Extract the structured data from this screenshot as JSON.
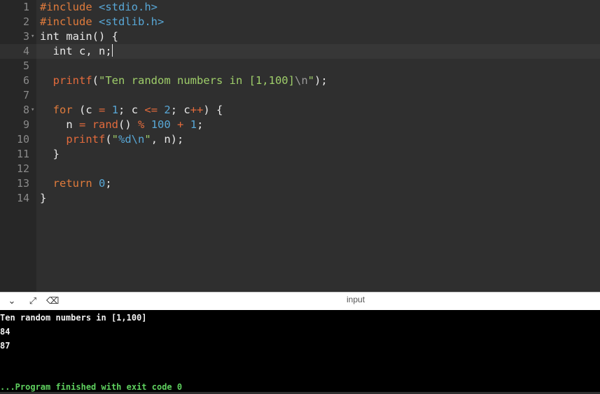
{
  "editor": {
    "lines": [
      {
        "n": "1",
        "tokens": [
          {
            "t": "#include ",
            "c": "pre"
          },
          {
            "t": "<stdio.h>",
            "c": "inc"
          }
        ]
      },
      {
        "n": "2",
        "tokens": [
          {
            "t": "#include ",
            "c": "pre"
          },
          {
            "t": "<stdlib.h>",
            "c": "inc"
          }
        ]
      },
      {
        "n": "3",
        "fold": "▾",
        "tokens": [
          {
            "t": "int main() {",
            "c": ""
          }
        ]
      },
      {
        "n": "4",
        "tokens": [
          {
            "t": "  int c, n;",
            "c": ""
          }
        ]
      },
      {
        "n": "5",
        "tokens": []
      },
      {
        "n": "6",
        "tokens": [
          {
            "t": "  ",
            "c": ""
          },
          {
            "t": "printf",
            "c": "fn"
          },
          {
            "t": "(",
            "c": ""
          },
          {
            "t": "\"Ten random numbers in [1,100]",
            "c": "str"
          },
          {
            "t": "\\n",
            "c": "esc"
          },
          {
            "t": "\"",
            "c": "str"
          },
          {
            "t": ");",
            "c": ""
          }
        ]
      },
      {
        "n": "7",
        "tokens": []
      },
      {
        "n": "8",
        "fold": "▾",
        "tokens": [
          {
            "t": "  ",
            "c": ""
          },
          {
            "t": "for",
            "c": "kw"
          },
          {
            "t": " (c ",
            "c": ""
          },
          {
            "t": "=",
            "c": "op"
          },
          {
            "t": " ",
            "c": ""
          },
          {
            "t": "1",
            "c": "num"
          },
          {
            "t": "; c ",
            "c": ""
          },
          {
            "t": "<=",
            "c": "op"
          },
          {
            "t": " ",
            "c": ""
          },
          {
            "t": "2",
            "c": "num"
          },
          {
            "t": "; c",
            "c": ""
          },
          {
            "t": "++",
            "c": "op"
          },
          {
            "t": ") {",
            "c": ""
          }
        ]
      },
      {
        "n": "9",
        "tokens": [
          {
            "t": "    n ",
            "c": ""
          },
          {
            "t": "=",
            "c": "op"
          },
          {
            "t": " ",
            "c": ""
          },
          {
            "t": "rand",
            "c": "fn"
          },
          {
            "t": "() ",
            "c": ""
          },
          {
            "t": "%",
            "c": "op"
          },
          {
            "t": " ",
            "c": ""
          },
          {
            "t": "100",
            "c": "num"
          },
          {
            "t": " ",
            "c": ""
          },
          {
            "t": "+",
            "c": "op"
          },
          {
            "t": " ",
            "c": ""
          },
          {
            "t": "1",
            "c": "num"
          },
          {
            "t": ";",
            "c": ""
          }
        ]
      },
      {
        "n": "10",
        "tokens": [
          {
            "t": "    ",
            "c": ""
          },
          {
            "t": "printf",
            "c": "fn"
          },
          {
            "t": "(",
            "c": ""
          },
          {
            "t": "\"",
            "c": "str"
          },
          {
            "t": "%d\\n",
            "c": "inc"
          },
          {
            "t": "\"",
            "c": "str"
          },
          {
            "t": ", n);",
            "c": ""
          }
        ]
      },
      {
        "n": "11",
        "tokens": [
          {
            "t": "  }",
            "c": ""
          }
        ]
      },
      {
        "n": "12",
        "tokens": []
      },
      {
        "n": "13",
        "tokens": [
          {
            "t": "  ",
            "c": ""
          },
          {
            "t": "return",
            "c": "kw"
          },
          {
            "t": " ",
            "c": ""
          },
          {
            "t": "0",
            "c": "num"
          },
          {
            "t": ";",
            "c": ""
          }
        ]
      },
      {
        "n": "14",
        "tokens": [
          {
            "t": "}",
            "c": ""
          }
        ]
      }
    ]
  },
  "toolbar": {
    "collapse_icon": "chevron-down-icon",
    "expand_icon": "expand-arrows-icon",
    "clear_icon": "clear-console-icon",
    "input_label": "input"
  },
  "console": {
    "lines": [
      "Ten random numbers in [1,100]",
      "84",
      "87"
    ],
    "finish_text": "...Program finished with exit code 0"
  },
  "colors": {
    "editor_bg": "#2f2f2f",
    "gutter_bg": "#272727",
    "keyword": "#e07b3c",
    "string": "#9fce6a",
    "number": "#58a7d6",
    "console_bg": "#000000",
    "finish": "#5fd15f"
  }
}
